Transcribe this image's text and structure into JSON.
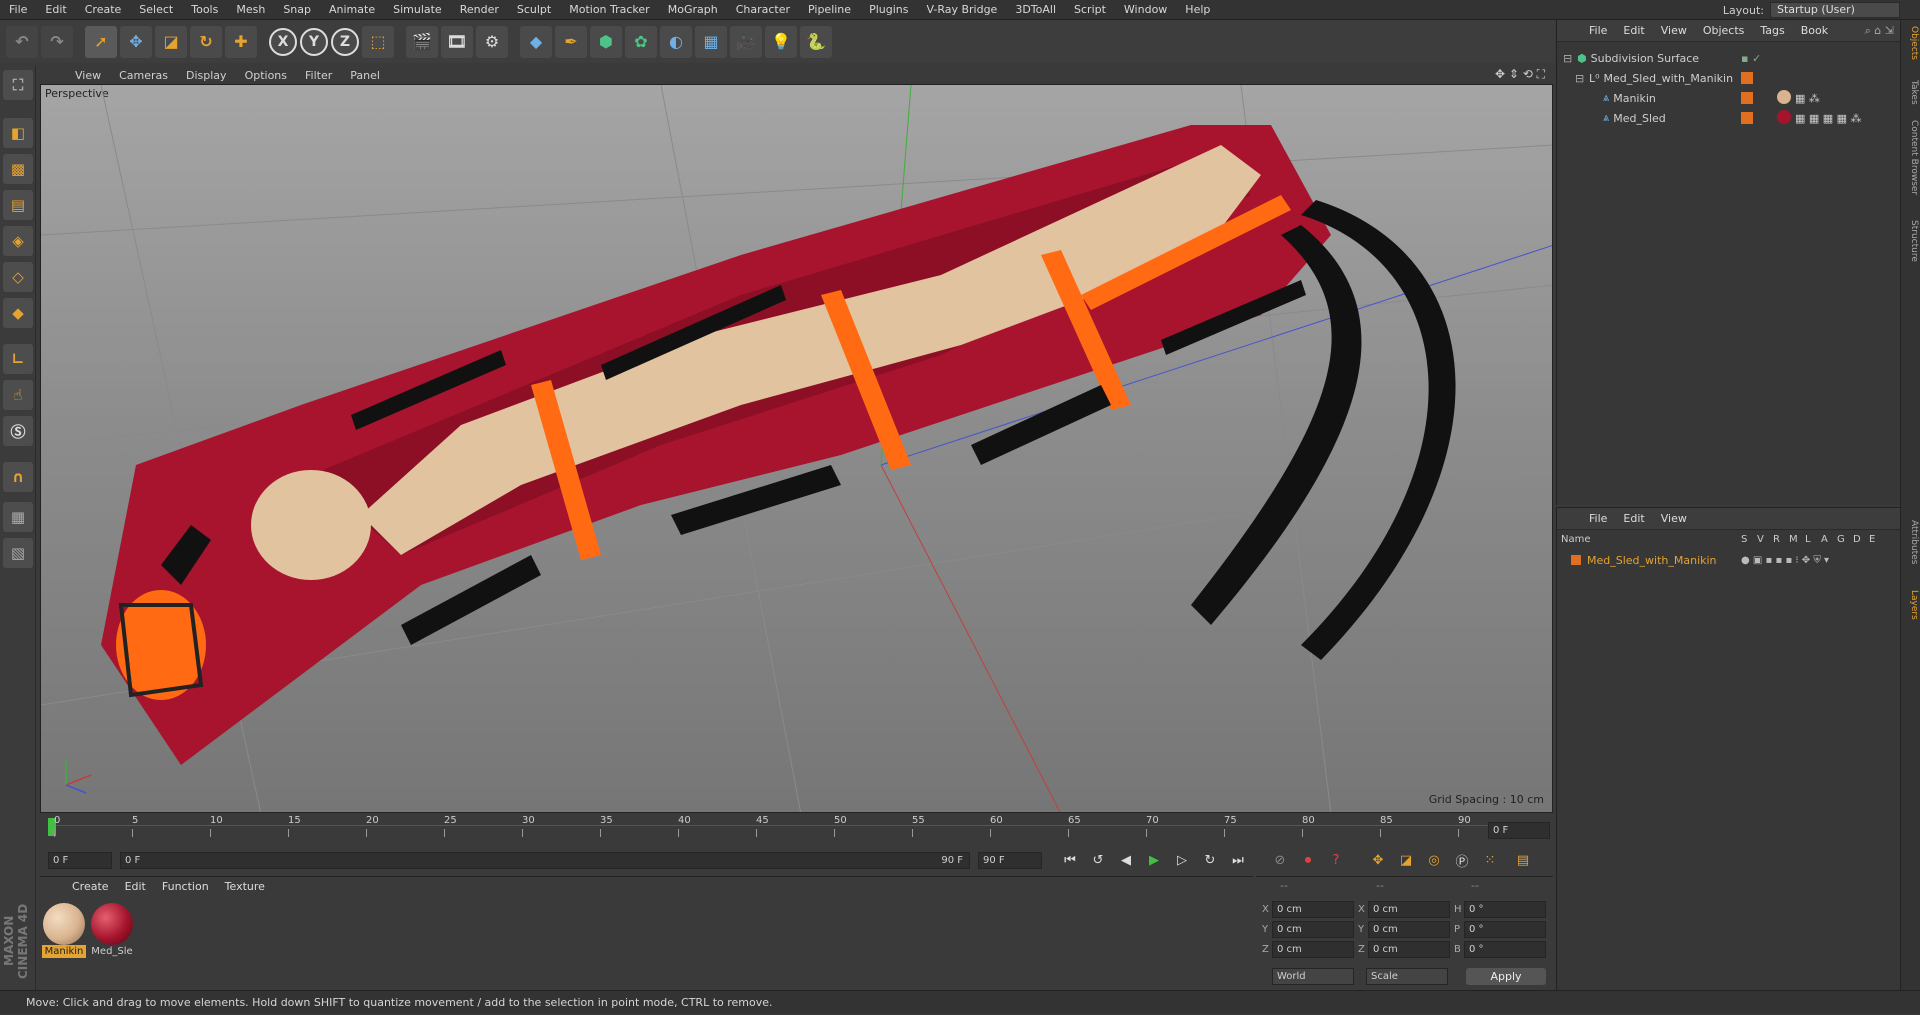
{
  "menu": [
    "File",
    "Edit",
    "Create",
    "Select",
    "Tools",
    "Mesh",
    "Snap",
    "Animate",
    "Simulate",
    "Render",
    "Sculpt",
    "Motion Tracker",
    "MoGraph",
    "Character",
    "Pipeline",
    "Plugins",
    "V-Ray Bridge",
    "3DToAll",
    "Script",
    "Window",
    "Help"
  ],
  "layout": {
    "label": "Layout:",
    "value": "Startup (User)"
  },
  "toolbar_icons": [
    "undo-icon",
    "redo-icon",
    "select-icon",
    "move-icon",
    "scale-icon",
    "rotate-icon",
    "add-icon",
    "x-axis-icon",
    "y-axis-icon",
    "z-axis-icon",
    "coordinate-system-icon",
    "render-view-icon",
    "render-picture-viewer-icon",
    "render-settings-icon",
    "cube-icon",
    "pen-icon",
    "subdivision-icon",
    "cloner-icon",
    "deformer-icon",
    "floor-icon",
    "camera-icon",
    "light-icon",
    "python-icon"
  ],
  "axis_labels": [
    "X",
    "Y",
    "Z"
  ],
  "viewport": {
    "menu": [
      "View",
      "Cameras",
      "Display",
      "Options",
      "Filter",
      "Panel"
    ],
    "label": "Perspective",
    "grid_spacing": "Grid Spacing : 10 cm"
  },
  "timeline": {
    "ticks": [
      "0",
      "5",
      "10",
      "15",
      "20",
      "25",
      "30",
      "35",
      "40",
      "45",
      "50",
      "55",
      "60",
      "65",
      "70",
      "75",
      "80",
      "85",
      "90"
    ],
    "current": "0 F"
  },
  "transport": {
    "start": "0 F",
    "range_start": "0 F",
    "range_end": "90 F",
    "end": "90 F"
  },
  "materials": {
    "menu": [
      "Create",
      "Edit",
      "Function",
      "Texture"
    ],
    "items": [
      {
        "name": "Manikin",
        "color": "#d9b38f"
      },
      {
        "name": "Med_Sle",
        "color": "#a5142c"
      }
    ]
  },
  "coords": {
    "rows": [
      {
        "a": "X",
        "av": "0 cm",
        "b": "X",
        "bv": "0 cm",
        "c": "H",
        "cv": "0 °"
      },
      {
        "a": "Y",
        "av": "0 cm",
        "b": "Y",
        "bv": "0 cm",
        "c": "P",
        "cv": "0 °"
      },
      {
        "a": "Z",
        "av": "0 cm",
        "b": "Z",
        "bv": "0 cm",
        "c": "B",
        "cv": "0 °"
      }
    ],
    "space": "World",
    "mode": "Scale",
    "apply": "Apply",
    "dash1": "--",
    "dash2": "--",
    "dash3": "--"
  },
  "objects": {
    "menu": [
      "File",
      "Edit",
      "View",
      "Objects",
      "Tags",
      "Book"
    ],
    "rows": [
      {
        "name": "Subdivision Surface",
        "indent": 0
      },
      {
        "name": "Med_Sled_with_Manikin",
        "indent": 1
      },
      {
        "name": "Manikin",
        "indent": 2
      },
      {
        "name": "Med_Sled",
        "indent": 2
      }
    ]
  },
  "layers": {
    "menu": [
      "File",
      "Edit",
      "View"
    ],
    "columns": [
      "Name",
      "S",
      "V",
      "R",
      "M",
      "L",
      "A",
      "G",
      "D",
      "E"
    ],
    "rows": [
      {
        "name": "Med_Sled_with_Manikin",
        "color": "#e07020"
      }
    ]
  },
  "right_tabs": [
    "Objects",
    "Takes",
    "Content Browser",
    "Structure",
    "Attributes",
    "Layers"
  ],
  "status": "Move: Click and drag to move elements. Hold down SHIFT to quantize movement / add to the selection in point mode, CTRL to remove.",
  "brand": "MAXON CINEMA 4D",
  "colors": {
    "accent": "#e5a330",
    "sled": "#a8142e",
    "strap": "#ff6a13",
    "skin": "#e2c39f"
  }
}
